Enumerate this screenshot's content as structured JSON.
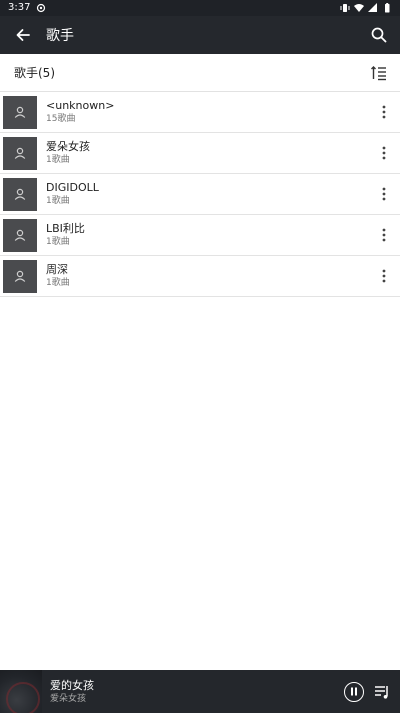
{
  "status_bar": {
    "time": "3:37",
    "icons": [
      "notification-icon",
      "vibrate-icon",
      "wifi-icon",
      "signal-icon",
      "battery-icon"
    ]
  },
  "toolbar": {
    "title": "歌手",
    "back_icon": "arrow-left-icon",
    "search_icon": "search-icon"
  },
  "subheader": {
    "title": "歌手(5)",
    "sort_icon": "sort-icon"
  },
  "artists": [
    {
      "name": "<unknown>",
      "count": "15歌曲"
    },
    {
      "name": "爱朵女孩",
      "count": "1歌曲"
    },
    {
      "name": "DIGIDOLL",
      "count": "1歌曲"
    },
    {
      "name": "LBI利比",
      "count": "1歌曲"
    },
    {
      "name": "周深",
      "count": "1歌曲"
    }
  ],
  "player": {
    "title": "爱的女孩",
    "artist": "爱朵女孩",
    "state": "playing"
  },
  "colors": {
    "toolbar_bg": "#25282d",
    "status_bg": "#1f2227",
    "avatar_bg": "#4a4b4e",
    "player_bg": "#24272c"
  }
}
